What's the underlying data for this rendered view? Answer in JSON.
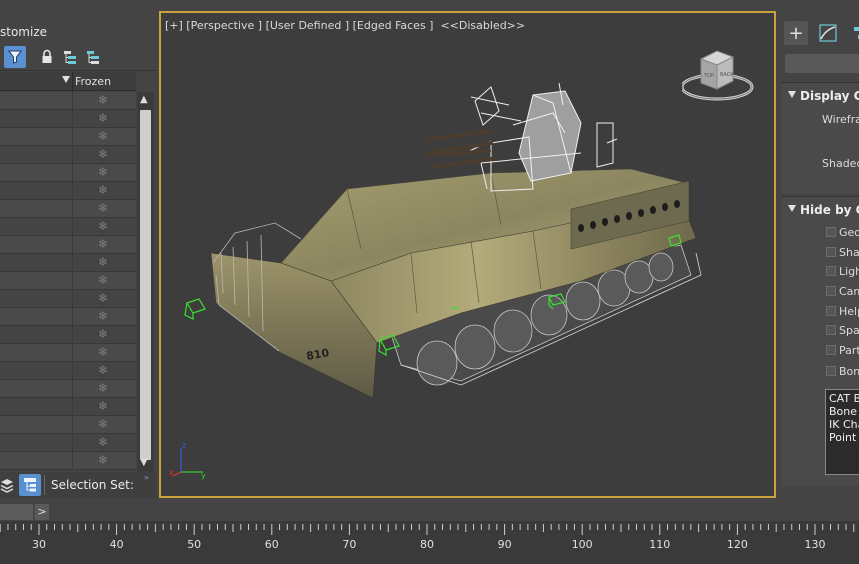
{
  "menu": {
    "customize_partial": "stomize"
  },
  "scene_explorer": {
    "column_header": "Frozen",
    "row_count": 21,
    "frozen_glyph": "❄",
    "selection_set_label": "Selection Set:"
  },
  "viewport": {
    "label": "[+] [Perspective ] [User Defined ] [Edged Faces ]  <<Disabled>>",
    "border_color": "#c9a23c",
    "viewcube_top": "TOP",
    "viewcube_back": "BACK",
    "axis_z": "z",
    "axis_x": "x",
    "axis_y": "y"
  },
  "command_panel": {
    "create_icon": "plus-icon",
    "rollouts": [
      {
        "title": "Display Co",
        "labels": [
          "Wirefran",
          "Shaded"
        ]
      },
      {
        "title": "Hide by Ca",
        "checkboxes": [
          "Geor",
          "Shap",
          "Ligh",
          "Cam",
          "Help",
          "Spac",
          "Part",
          "Bone"
        ]
      }
    ],
    "list_items": [
      "CAT B",
      "Bone",
      "IK Cha",
      "Point"
    ]
  },
  "timeline": {
    "next_label": ">",
    "ticks": [
      "30",
      "40",
      "50",
      "60",
      "70",
      "80",
      "90",
      "100",
      "110",
      "120",
      "130"
    ]
  }
}
